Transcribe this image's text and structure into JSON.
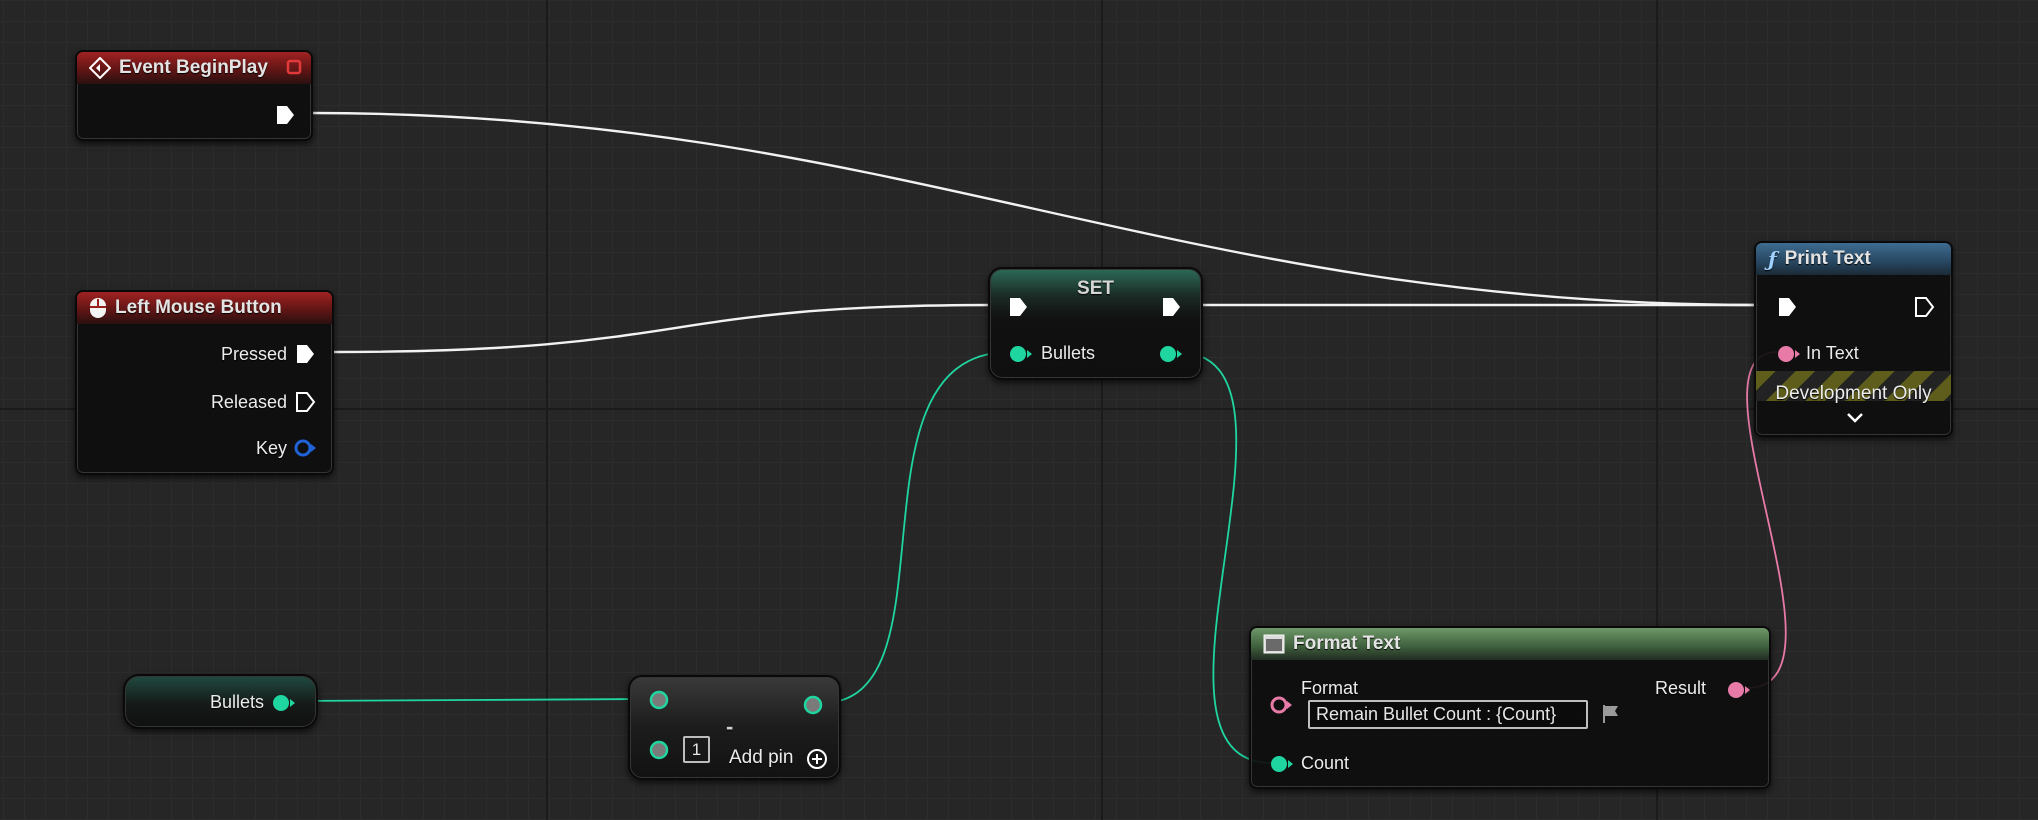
{
  "nodes": {
    "event_begin_play": {
      "title": "Event BeginPlay"
    },
    "left_mouse_button": {
      "title": "Left Mouse Button",
      "pins": {
        "pressed": "Pressed",
        "released": "Released",
        "key": "Key"
      }
    },
    "bullets_getter": {
      "label": "Bullets"
    },
    "subtract": {
      "op_symbol": "-",
      "input_value": "1",
      "add_pin": "Add pin"
    },
    "set": {
      "title": "SET",
      "pin": "Bullets"
    },
    "print_text": {
      "title": "Print Text",
      "in_text": "In Text",
      "banner": "Development Only"
    },
    "format_text": {
      "title": "Format Text",
      "format_label": "Format",
      "format_value": "Remain Bullet Count : {Count}",
      "result_label": "Result",
      "count_label": "Count"
    }
  },
  "colors": {
    "exec": "#ffffff",
    "integer": "#1fd5a0",
    "text": "#e87aa8",
    "struct": "#1f63d6",
    "event_header": "#a12222",
    "function_header": "#3e6c90",
    "pure_header": "#6e9868",
    "stop_square": "#e23a3a"
  },
  "icons": {
    "event": "diamond-event-icon",
    "mouse": "mouse-icon",
    "function": "function-f-icon",
    "format_text": "format-text-icon",
    "expand": "chevron-down-icon",
    "add_pin": "add-circle-icon",
    "localize": "flag-icon"
  }
}
